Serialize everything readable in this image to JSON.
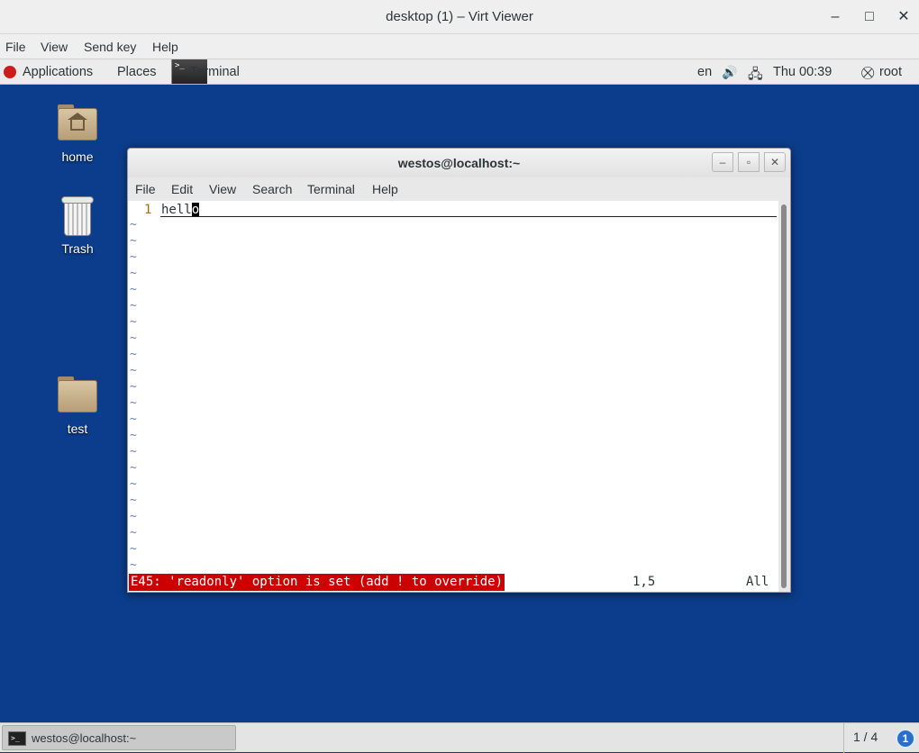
{
  "viewer": {
    "title": "desktop (1) – Virt Viewer",
    "controls": {
      "minimize": "–",
      "maximize": "□",
      "close": "✕"
    },
    "menu": [
      "File",
      "View",
      "Send key",
      "Help"
    ]
  },
  "topbar": {
    "applications": "Applications",
    "places": "Places",
    "terminal": "Terminal",
    "terminal_glyph": ">_",
    "lang": "en",
    "volume_icon": "🔊",
    "network_icon": "🖧",
    "clock": "Thu 00:39",
    "user_icon": "⛒",
    "user": "root"
  },
  "desktop": {
    "icons": [
      {
        "label": "home",
        "icon": "home-folder-icon"
      },
      {
        "label": "Trash",
        "icon": "trash-icon"
      },
      {
        "label": "test",
        "icon": "folder-icon"
      }
    ]
  },
  "terminal": {
    "title": "westos@localhost:~",
    "buttons": {
      "minimize": "‒",
      "maximize": "▫",
      "close": "✕"
    },
    "menu": [
      "File",
      "Edit",
      "View",
      "Search",
      "Terminal",
      "Help"
    ],
    "vim": {
      "line_number": "1",
      "text_before_cursor": "hell",
      "cursor_char": "o",
      "tilde": "~",
      "error": "E45: 'readonly' option is set (add ! to override)",
      "position": "1,5",
      "scroll": "All"
    }
  },
  "taskbar": {
    "window_label": "westos@localhost:~",
    "window_icon_glyph": ">_",
    "workspace": "1 / 4",
    "notifications": "1"
  }
}
